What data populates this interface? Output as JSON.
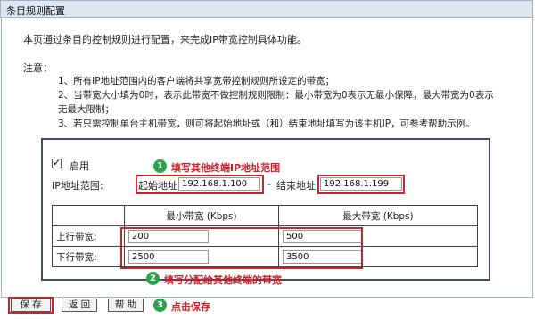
{
  "title": "条目规则配置",
  "intro": "本页通过条目的控制规则进行配置，来完成IP带宽控制具体功能。",
  "notes": {
    "label": "注意：",
    "items": [
      "1、所有IP地址范围内的客户端将共享宽带控制规则所设定的带宽；",
      "2、当带宽大小填为0时，表示此带宽不做控制规则限制：最小带宽为0表示无最小保障，最大带宽为0表示",
      "无最大限制；",
      "3、若只需控制单台主机带宽，则可将起始地址或（和）结束地址填写为该主机IP，可参考帮助示例。"
    ]
  },
  "form": {
    "enable_label": "启用",
    "enabled": true,
    "ip_range_label": "IP地址范围:",
    "start_label": "起始地址",
    "start_value": "192.168.1.100",
    "dash": "-",
    "end_label": "结束地址",
    "end_value": "192.168.1.199"
  },
  "bandwidth": {
    "col_min": "最小带宽 (Kbps)",
    "col_max": "最大带宽 (Kbps)",
    "up_label": "上行带宽:",
    "down_label": "下行带宽:",
    "up_min": "200",
    "up_max": "500",
    "down_min": "2500",
    "down_max": "3500"
  },
  "annotations": {
    "a1_num": "1",
    "a1_text": "填写其他终端IP地址范围",
    "a2_num": "2",
    "a2_text": "填写分配给其他终端的带宽",
    "a3_num": "3",
    "a3_text": "点击保存"
  },
  "buttons": {
    "save": "保 存",
    "back": "返 回",
    "help": "帮 助"
  },
  "colors": {
    "annotation_red": "#d11f26",
    "annotation_green": "#27a34b",
    "panel_border": "#3a4f74"
  }
}
